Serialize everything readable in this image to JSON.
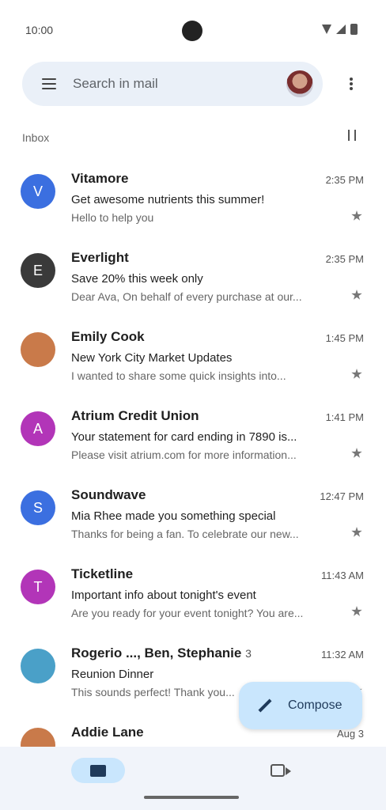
{
  "status": {
    "time": "10:00"
  },
  "search": {
    "placeholder": "Search in mail"
  },
  "section": {
    "label": "Inbox"
  },
  "emails": [
    {
      "sender": "Vitamore",
      "time": "2:35 PM",
      "subject": "Get awesome nutrients this summer!",
      "preview": "Hello to help you",
      "avatar_letter": "V",
      "avatar_color": "#3b6fe0"
    },
    {
      "sender": "Everlight",
      "time": "2:35 PM",
      "subject": "Save 20% this week only",
      "preview": "Dear Ava, On behalf of every purchase at our...",
      "avatar_letter": "E",
      "avatar_color": "#3a3a3a"
    },
    {
      "sender": "Emily Cook",
      "time": "1:45 PM",
      "subject": "New York City Market Updates",
      "preview": "I wanted to share some quick insights into...",
      "avatar_letter": "",
      "avatar_color": "#c97a4a"
    },
    {
      "sender": "Atrium Credit Union",
      "time": "1:41 PM",
      "subject": "Your statement for card ending in 7890 is...",
      "preview": "Please visit atrium.com for more information...",
      "avatar_letter": "A",
      "avatar_color": "#b235b8"
    },
    {
      "sender": "Soundwave",
      "time": "12:47 PM",
      "subject": "Mia Rhee made you something special",
      "preview": "Thanks for being a fan. To celebrate our new...",
      "avatar_letter": "S",
      "avatar_color": "#3b6fe0"
    },
    {
      "sender": "Ticketline",
      "time": "11:43 AM",
      "subject": "Important info about tonight's event",
      "preview": "Are you ready for your event tonight? You are...",
      "avatar_letter": "T",
      "avatar_color": "#b235b8"
    },
    {
      "sender": "Rogerio ..., Ben, Stephanie",
      "count": "3",
      "time": "11:32 AM",
      "subject": "Reunion Dinner",
      "preview": "This sounds perfect! Thank you...",
      "avatar_letter": "",
      "avatar_color": "#4aa0c8"
    },
    {
      "sender": "Addie Lane",
      "time": "Aug 3",
      "subject": "",
      "preview": "",
      "avatar_letter": "",
      "avatar_color": "#c97a4a"
    }
  ],
  "fab": {
    "label": "Compose"
  },
  "icons": {
    "menu": "menu-icon",
    "more": "more-vert-icon",
    "filter": "filter-icon",
    "star": "star-icon",
    "pencil": "pencil-icon",
    "mail": "mail-icon",
    "meet": "video-icon"
  },
  "colors": {
    "accent": "#c9e6fd",
    "search_bg": "#eaf0f8",
    "nav_bg": "#f1f4fa"
  }
}
